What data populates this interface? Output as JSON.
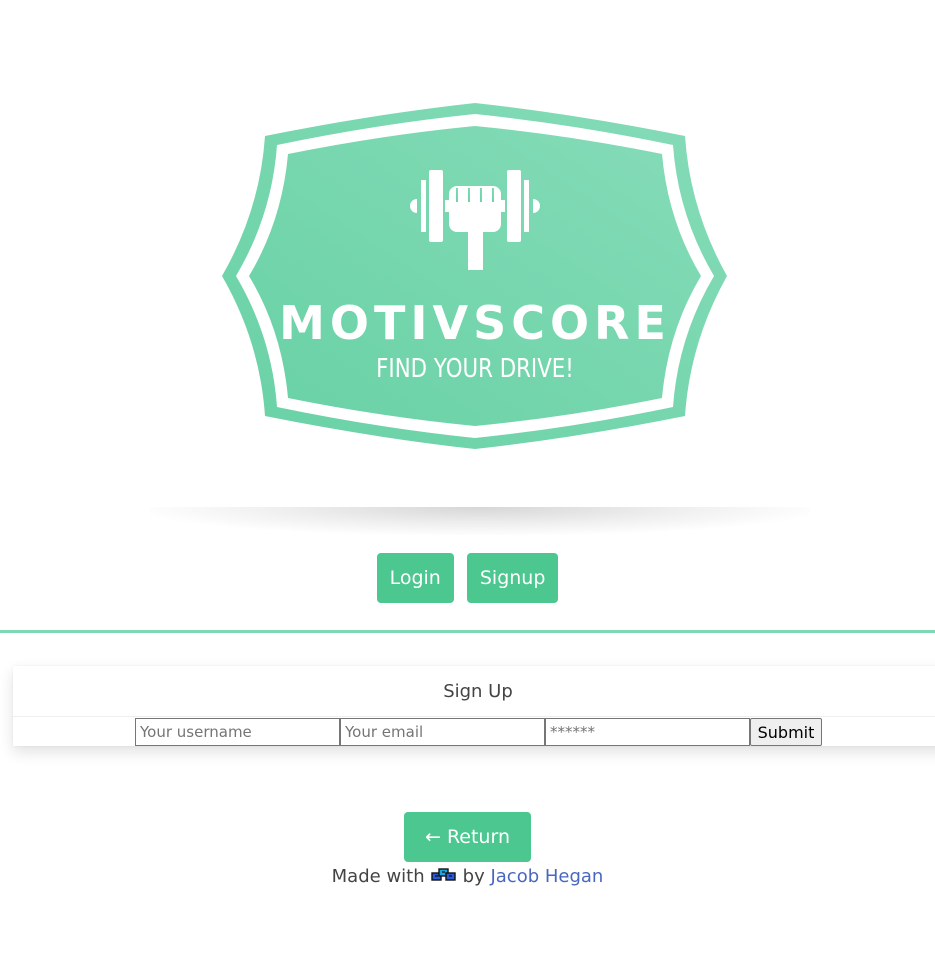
{
  "logo": {
    "title": "MOTIVSCORE",
    "tagline": "FIND YOUR DRIVE!",
    "icon": "dumbbell-fist-icon",
    "color": "#74d7ae"
  },
  "nav": {
    "login_label": "Login",
    "signup_label": "Signup"
  },
  "signup_form": {
    "heading": "Sign Up",
    "username_placeholder": "Your username",
    "email_placeholder": "Your email",
    "password_placeholder": "******",
    "submit_label": "Submit"
  },
  "return_label": "← Return",
  "footer": {
    "made_with": "Made with",
    "icon": "fire-icon",
    "by": "by",
    "author": "Jacob Hegan"
  },
  "colors": {
    "accent": "#4cc790",
    "divider": "#7fd8b4",
    "link": "#4a67c0"
  }
}
